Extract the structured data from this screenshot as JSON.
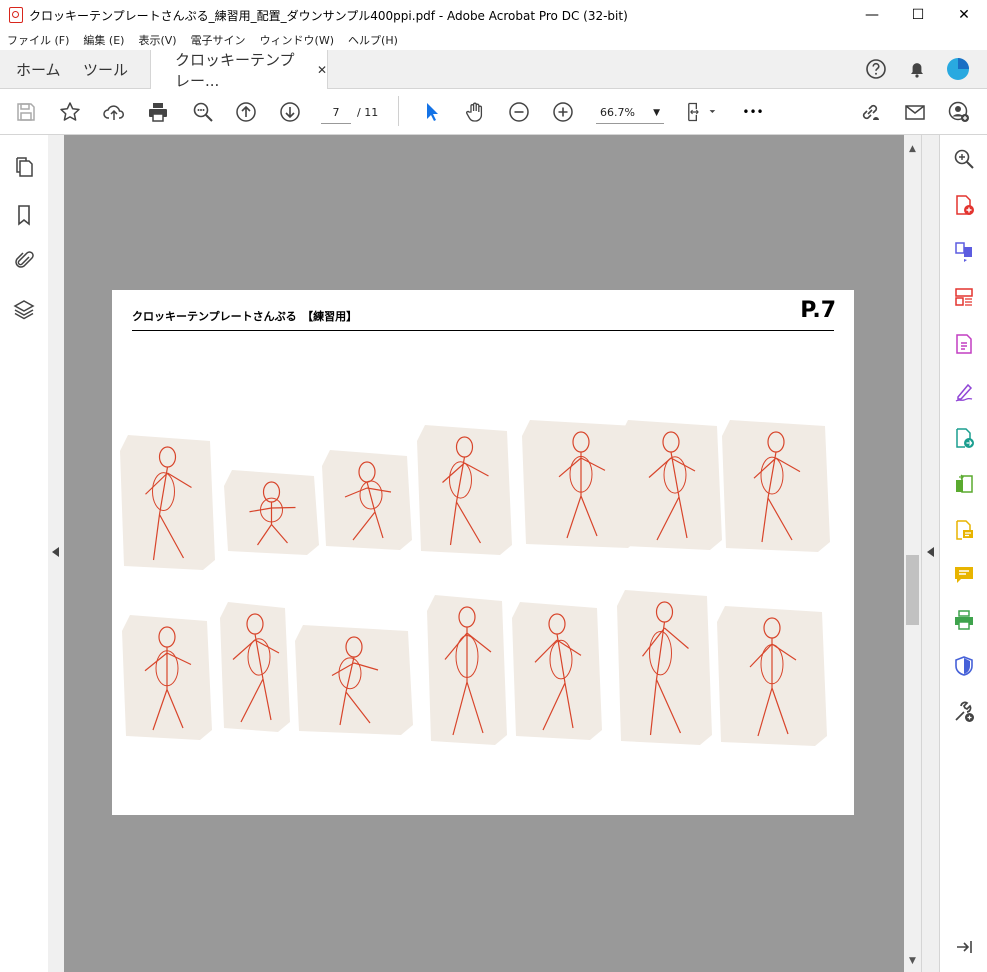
{
  "window": {
    "title": "クロッキーテンプレートさんぷる_練習用_配置_ダウンサンプル400ppi.pdf - Adobe Acrobat Pro DC (32-bit)",
    "minimize": "—",
    "maximize": "☐",
    "close": "✕"
  },
  "menu": [
    "ファイル (F)",
    "編集 (E)",
    "表示(V)",
    "電子サイン",
    "ウィンドウ(W)",
    "ヘルプ(H)"
  ],
  "tabs": {
    "home": "ホーム",
    "tools": "ツール",
    "doc": "クロッキーテンプレー...",
    "doc_close": "✕"
  },
  "toolbar": {
    "page_current": "7",
    "page_total": "/ 11",
    "zoom": "66.7%",
    "zoom_arrow": "▼",
    "more": "•••"
  },
  "page": {
    "title": "クロッキーテンプレートさんぷる　【練習用】",
    "number": "P.7"
  },
  "colors": {
    "sketch": "#d8452b",
    "paper": "#f1ebe4",
    "accent_blue": "#1473e6"
  },
  "icons": {
    "left": [
      "pages-icon",
      "bookmark-icon",
      "attachment-icon",
      "layers-icon"
    ],
    "right": [
      "zoom-search-icon",
      "create-pdf-icon",
      "combine-files-icon",
      "organize-pages-icon",
      "edit-pdf-icon",
      "fill-sign-icon",
      "export-pdf-icon",
      "compress-icon",
      "request-sign-icon",
      "comment-icon",
      "print-production-icon",
      "protect-icon",
      "more-tools-icon",
      "collapse-panel-icon"
    ]
  }
}
